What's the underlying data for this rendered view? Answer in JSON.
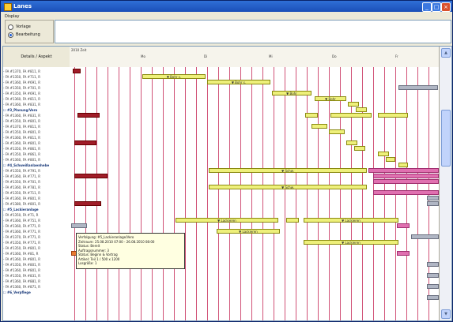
{
  "window": {
    "title": "Lanes"
  },
  "display": {
    "legend": "Display",
    "option_1": "Vorlage",
    "option_2": "Bearbeitung",
    "selected": 2
  },
  "gantt": {
    "name_header": "Details / Aspekt",
    "header_corner": "2010 Zeit",
    "month_labels": [
      "Mo",
      "Di",
      "Mi",
      "Do",
      "Fr"
    ],
    "row_labels": [
      "- FA #1370, FA #811, R",
      "- FA #1350, FA #711, R",
      "- FA #1360, FA #691, R",
      "- FA #1350, FA #701, R",
      "- FA #1350, FA #691, R",
      "- FA #1360, FA #811, R",
      "- FA #1360, FA #831, R",
      "☐ #3_Planung/Vero",
      "- FA #1360, FA #831, R",
      "- FA #1350, FA #801, R",
      "- FA #1370, FA #811, R",
      "- FA #1350, FA #801, R",
      "- FA #1360, FA #811, R",
      "- FA #1360, FA #801, R",
      "- FA #1350, FA #861, R",
      "- FA #1350, FA #861, R",
      "- FA #1360, FA #801, R",
      "☐ #4_Schweißanlaenhebe",
      "- FA #1350, FA #791, R",
      "- FA #1360, FA #771, R",
      "- FA #1350, FA #701, R",
      "- FA #1360, FA #781, R",
      "- FA #1350, FA #711, R",
      "- FA #1360, FA #801, R",
      "- FA #1380, FA #801, R",
      "☐ #5_Lackieranlage",
      "- FA #1350, FA #71, R",
      "- FA #1360, FA #751, R",
      "- FA #1360, FA #771, R",
      "- FA #1360, FA #771, R",
      "- FA #1370, FA #771, R",
      "- FA #1350, FA #771, R",
      "- FA #1350, FA #801, R",
      "- FA #1360, FA #81, R",
      "- FA #1360, FA #801, R",
      "- FA #1350, FA #801, R",
      "- FA #1360, FA #801, R",
      "- FA #1350, FA #831, R",
      "- FA #1360, FA #881, R",
      "- FA #1360, FA #871, R",
      "☐ #6_Verpflege"
    ],
    "bar_labels": {
      "b1": "▼ Bohr s.",
      "b2": "▼ Bohr s.",
      "b3": "▼ Bohr",
      "b4": "▼ Bohr",
      "b5": "▼ Bohr",
      "b6": "▼ Bohr",
      "b7": "▼ Schw.",
      "b8": "▼ Schw.",
      "b9": "▼ Lackieren",
      "b10": "▼ Lackieren",
      "b11": "▼ Lackieren",
      "b12": "▼ Lackieren"
    }
  },
  "tooltip": {
    "line1": "Verfolgung: #5_Lackieranlage/Vero",
    "line2": "Zeitraum: 25.08.2010 07:00 - 26.08.2010 08:00",
    "line3": "Status: Bereit",
    "line4": "Auftragsnummer: 3",
    "line5": "Status: Beginn & Vortrag",
    "line6": "Artikel: Teil 1 / 500 x 1200",
    "line7": "Losgröße: 1"
  }
}
